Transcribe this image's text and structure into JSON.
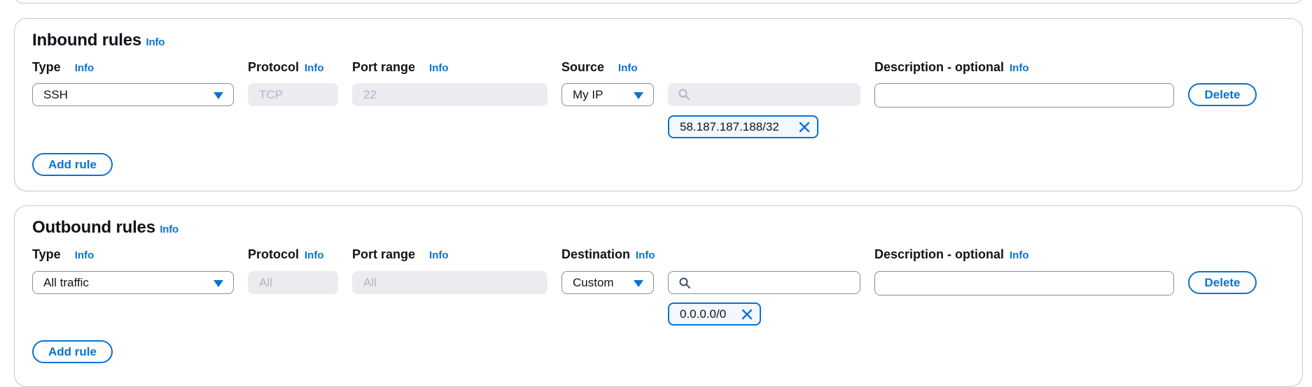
{
  "inbound": {
    "title": "Inbound rules",
    "title_info": "Info",
    "labels": {
      "type": "Type",
      "protocol": "Protocol",
      "port_range": "Port range",
      "source": "Source",
      "description": "Description - optional"
    },
    "info": "Info",
    "rule": {
      "type": "SSH",
      "protocol": "TCP",
      "port_range": "22",
      "source": "My IP",
      "search_placeholder": "",
      "token": "58.187.187.188/32",
      "description": ""
    },
    "delete_label": "Delete",
    "add_rule_label": "Add rule"
  },
  "outbound": {
    "title": "Outbound rules",
    "title_info": "Info",
    "labels": {
      "type": "Type",
      "protocol": "Protocol",
      "port_range": "Port range",
      "destination": "Destination",
      "description": "Description - optional"
    },
    "info": "Info",
    "rule": {
      "type": "All traffic",
      "protocol": "All",
      "port_range": "All",
      "destination": "Custom",
      "search_placeholder": "",
      "token": "0.0.0.0/0",
      "description": ""
    },
    "delete_label": "Delete",
    "add_rule_label": "Add rule"
  },
  "colors": {
    "accent": "#0972d3",
    "border": "#c6c6cd",
    "disabled_bg": "#ebebf0",
    "disabled_text": "#b4b4bb"
  },
  "icons": [
    "caret-down-icon",
    "search-icon",
    "close-icon"
  ]
}
